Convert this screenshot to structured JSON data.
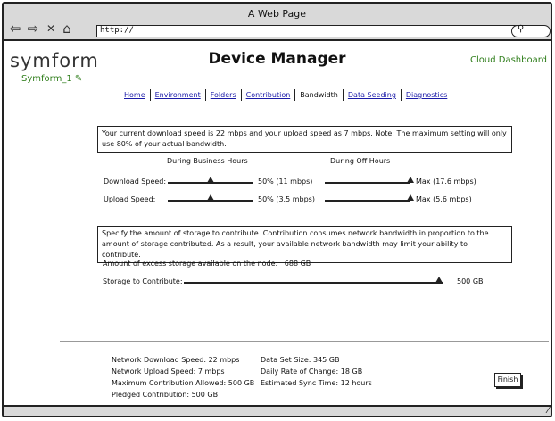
{
  "browser": {
    "title": "A Web Page",
    "url": "http://",
    "back_icon": "back-arrow-icon",
    "forward_icon": "forward-arrow-icon",
    "stop_icon": "close-icon",
    "home_icon": "home-icon",
    "search_icon": "search-icon"
  },
  "header": {
    "logo": "symform",
    "user": "Symform_1",
    "title": "Device Manager",
    "cloud_link": "Cloud Dashboard"
  },
  "nav": {
    "tabs": [
      {
        "label": "Home"
      },
      {
        "label": "Environment"
      },
      {
        "label": "Folders"
      },
      {
        "label": "Contribution"
      },
      {
        "label": "Bandwidth"
      },
      {
        "label": "Data Seeding"
      },
      {
        "label": "Diagnostics"
      }
    ],
    "active": "Bandwidth"
  },
  "bandwidth": {
    "note": "Your current download speed is 22 mbps and your upload speed as 7 mbps. Note: The maximum setting will only use 80% of your actual bandwidth.",
    "business_header": "During Business Hours",
    "offhours_header": "During Off Hours",
    "download_label": "Download Speed:",
    "upload_label": "Upload Speed:",
    "download_business_value": "50% (11 mbps)",
    "upload_business_value": "50% (3.5 mbps)",
    "download_offhours_value": "Max (17.6 mbps)",
    "upload_offhours_value": "Max (5.6 mbps)",
    "download_business_fraction": 0.5,
    "upload_business_fraction": 0.5,
    "download_offhours_fraction": 1.0,
    "upload_offhours_fraction": 1.0
  },
  "storage": {
    "note": "Specify the amount of storage to contribute. Contribution consumes network bandwidth in proportion to the amount of storage contributed. As a result, your available network bandwidth may limit your ability to contribute.",
    "excess_label": "Amount of excess storage available on the node:",
    "excess_value": "688 GB",
    "contribute_label": "Storage to Contribute:",
    "contribute_value": "500 GB"
  },
  "stats": {
    "col1": [
      "Network Download Speed: 22 mbps",
      "Network Upload Speed: 7 mbps",
      "Maximum Contribution Allowed: 500 GB",
      "Pledged Contribution: 500 GB"
    ],
    "col2": [
      "Data Set Size: 345 GB",
      "Daily Rate of Change: 18 GB",
      "Estimated Sync Time: 12 hours"
    ]
  },
  "finish_label": "Finish"
}
